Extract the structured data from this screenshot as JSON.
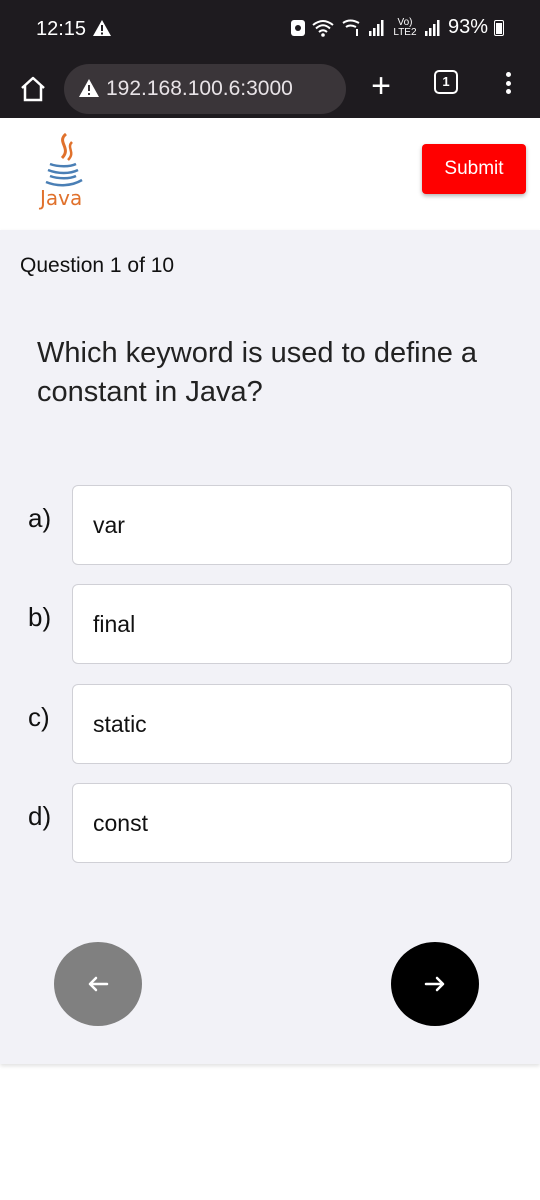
{
  "status_bar": {
    "time": "12:15",
    "network": "Vo) LTE2",
    "battery": "93%"
  },
  "browser": {
    "url": "192.168.100.6:3000",
    "tab_count": "1",
    "icons": [
      "home-icon",
      "warning-icon",
      "plus-icon",
      "tabs-icon",
      "more-icon"
    ]
  },
  "header": {
    "logo_text": "Java",
    "submit_label": "Submit",
    "submit_color": "#ff0000"
  },
  "quiz": {
    "progress": "Question 1 of 10",
    "question": "Which keyword is used to define a constant in Java?",
    "options": [
      {
        "letter": "a)",
        "text": "var"
      },
      {
        "letter": "b)",
        "text": "final"
      },
      {
        "letter": "c)",
        "text": "static"
      },
      {
        "letter": "d)",
        "text": "const"
      }
    ],
    "prev_label": "←",
    "next_label": "→"
  }
}
